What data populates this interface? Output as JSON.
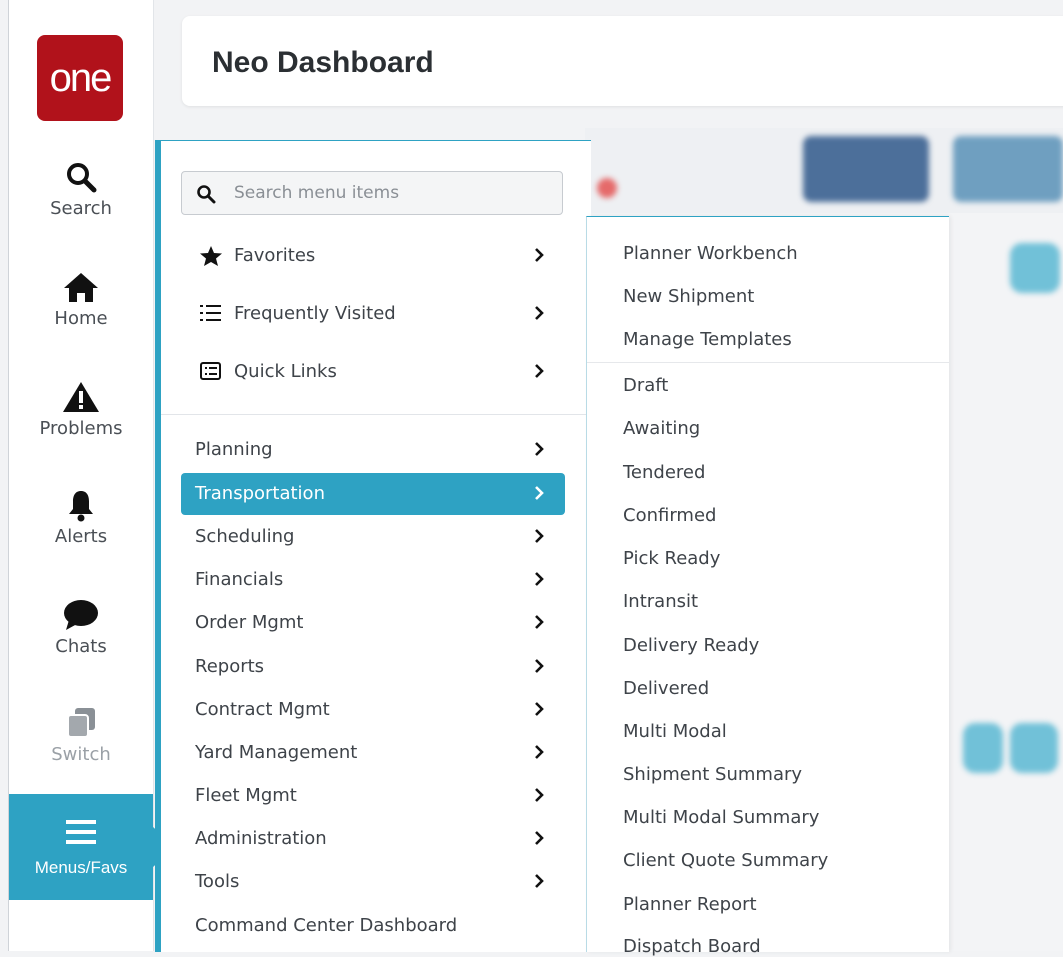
{
  "header": {
    "title": "Neo Dashboard"
  },
  "logo": {
    "text": "one"
  },
  "leftnav": [
    {
      "label": "Search",
      "icon": "search-icon"
    },
    {
      "label": "Home",
      "icon": "home-icon"
    },
    {
      "label": "Problems",
      "icon": "warning-icon"
    },
    {
      "label": "Alerts",
      "icon": "bell-icon"
    },
    {
      "label": "Chats",
      "icon": "chat-icon"
    },
    {
      "label": "Switch",
      "icon": "switch-icon"
    },
    {
      "label": "Menus/Favs",
      "icon": "menu-icon"
    }
  ],
  "search": {
    "placeholder": "Search menu items"
  },
  "quick": [
    {
      "label": "Favorites",
      "icon": "star-icon"
    },
    {
      "label": "Frequently Visited",
      "icon": "list-icon"
    },
    {
      "label": "Quick Links",
      "icon": "links-icon"
    }
  ],
  "menu": [
    "Planning",
    "Transportation",
    "Scheduling",
    "Financials",
    "Order Mgmt",
    "Reports",
    "Contract Mgmt",
    "Yard Management",
    "Fleet Mgmt",
    "Administration",
    "Tools",
    "Command Center Dashboard"
  ],
  "submenu": [
    "Planner Workbench",
    "New Shipment",
    "Manage Templates",
    "Draft",
    "Awaiting",
    "Tendered",
    "Confirmed",
    "Pick Ready",
    "Intransit",
    "Delivery Ready",
    "Delivered",
    "Multi Modal",
    "Shipment Summary",
    "Multi Modal Summary",
    "Client Quote Summary",
    "Planner Report",
    "Dispatch Board"
  ],
  "colors": {
    "accent": "#2ea2c3",
    "brand": "#b1121b"
  }
}
